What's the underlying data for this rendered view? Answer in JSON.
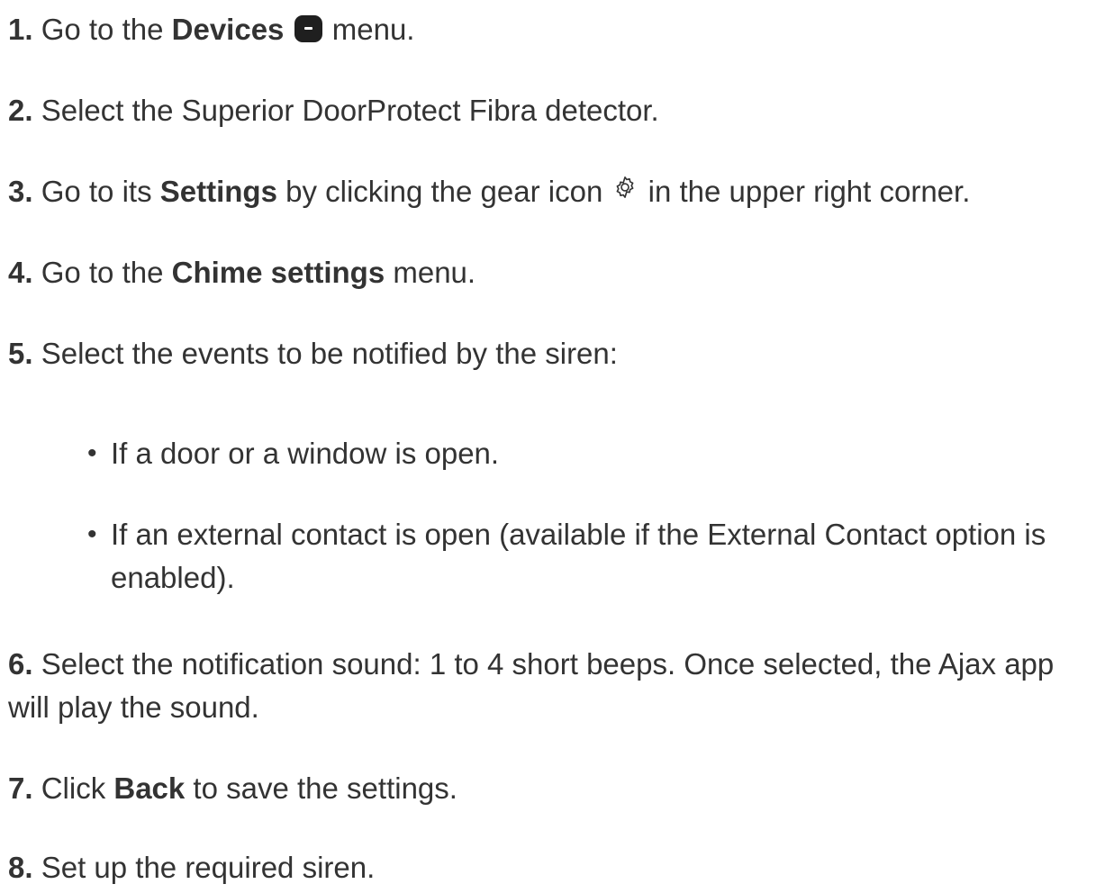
{
  "steps": [
    {
      "num": "1.",
      "pre": "Go to the ",
      "bold": "Devices",
      "post": " menu.",
      "icon": "devices-icon"
    },
    {
      "num": "2.",
      "text": "Select the Superior DoorProtect Fibra detector."
    },
    {
      "num": "3.",
      "pre": "Go to its ",
      "bold": "Settings",
      "mid": " by clicking the gear icon ",
      "post": " in the upper right corner.",
      "icon": "gear-icon"
    },
    {
      "num": "4.",
      "pre": "Go to the ",
      "bold": "Chime settings",
      "post": " menu."
    },
    {
      "num": "5.",
      "text": "Select the events to be notified by the siren:"
    },
    {
      "num": "6.",
      "text": "Select the notification sound: 1 to 4 short beeps. Once selected, the Ajax app will play the sound."
    },
    {
      "num": "7.",
      "pre": "Click ",
      "bold": "Back",
      "post": " to save the settings."
    },
    {
      "num": "8.",
      "text": "Set up the required siren."
    }
  ],
  "sub_items": [
    "If a door or a window is open.",
    "If an external contact is open (available if the External Contact option is enabled)."
  ],
  "colors": {
    "text": "#333333",
    "icon": "#1f1f1f"
  }
}
